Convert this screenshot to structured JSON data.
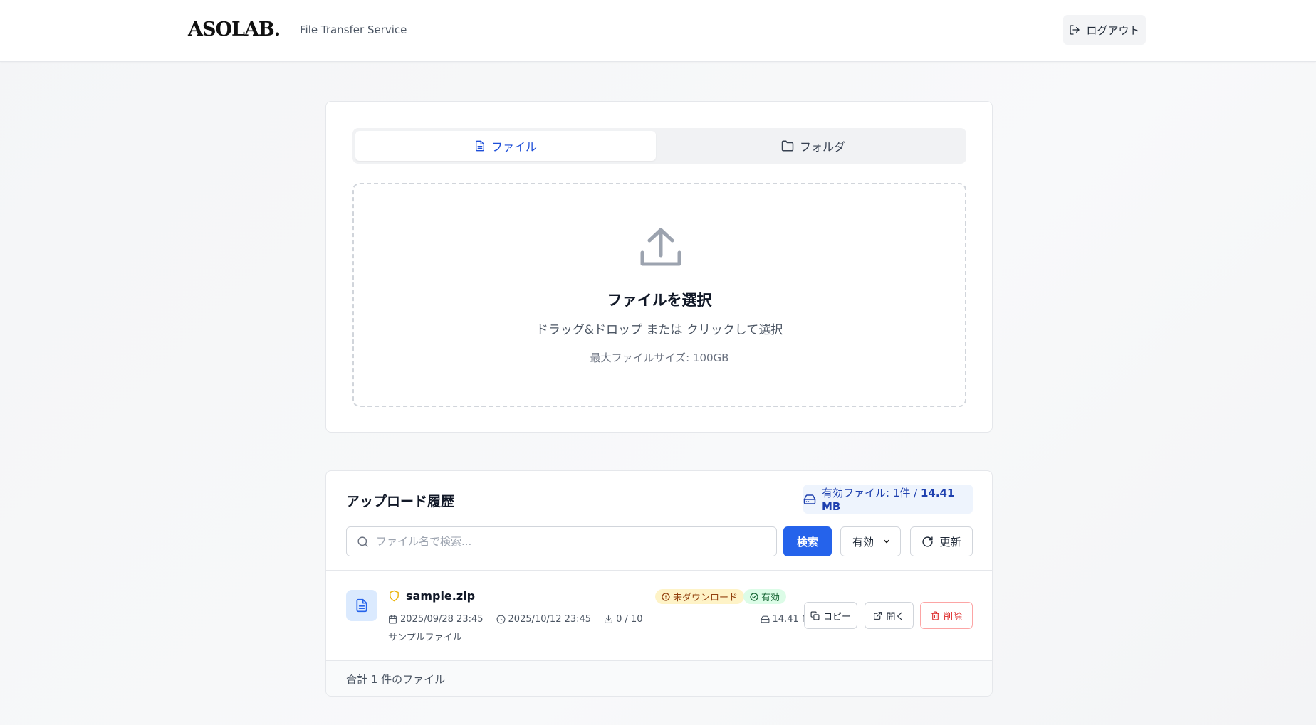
{
  "header": {
    "logo": "ASOLAB.",
    "subtitle": "File Transfer Service",
    "logout_label": "ログアウト"
  },
  "upload": {
    "tabs": [
      {
        "label": "ファイル",
        "icon": "file-icon",
        "active": true
      },
      {
        "label": "フォルダ",
        "icon": "folder-icon",
        "active": false
      }
    ],
    "dropzone": {
      "icon": "upload-icon",
      "title": "ファイルを選択",
      "subtitle": "ドラッグ&ドロップ または クリックして選択",
      "max_size": "最大ファイルサイズ: 100GB"
    }
  },
  "history": {
    "title": "アップロード履歴",
    "stats_prefix": "有効ファイル: 1件 / ",
    "stats_size": "14.41 MB",
    "search_placeholder": "ファイル名で検索...",
    "search_button": "検索",
    "status_filter": "有効",
    "refresh_button": "更新",
    "files": [
      {
        "name": "sample.zip",
        "uploaded": "2025/09/28 23:45",
        "expires": "2025/10/12 23:45",
        "downloads": "0 / 10",
        "description": "サンプルファイル",
        "badge_download": "未ダウンロード",
        "badge_status": "有効",
        "size": "14.41 MB",
        "copy_label": "コピー",
        "open_label": "開く",
        "delete_label": "削除"
      }
    ],
    "footer": "合計 1 件のファイル"
  },
  "colors": {
    "primary": "#2563eb",
    "danger": "#dc2626",
    "badge_pending_bg": "#fef3c7",
    "badge_valid_bg": "#dcfce7"
  }
}
